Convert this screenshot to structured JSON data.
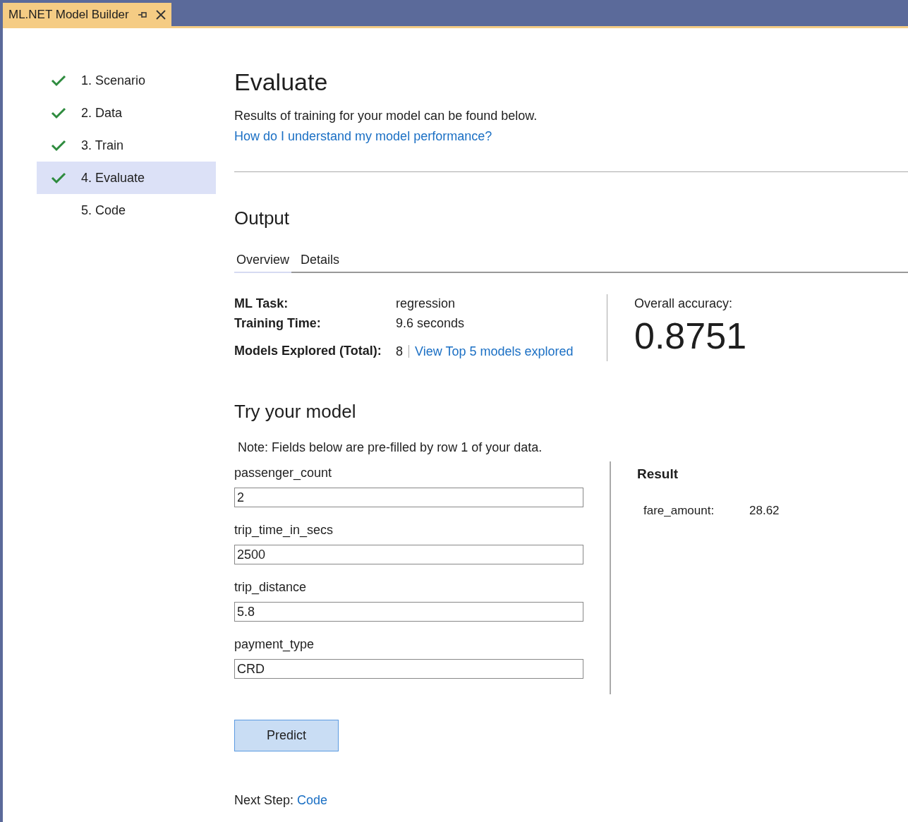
{
  "window": {
    "tab_title": "ML.NET Model Builder"
  },
  "steps": [
    {
      "label": "1. Scenario",
      "completed": true,
      "selected": false
    },
    {
      "label": "2. Data",
      "completed": true,
      "selected": false
    },
    {
      "label": "3. Train",
      "completed": true,
      "selected": false
    },
    {
      "label": "4. Evaluate",
      "completed": true,
      "selected": true
    },
    {
      "label": "5. Code",
      "completed": false,
      "selected": false
    }
  ],
  "page": {
    "title": "Evaluate",
    "intro": "Results of training for your model can be found below.",
    "help_link": "How do I understand my model performance?"
  },
  "output": {
    "heading": "Output",
    "tabs": [
      {
        "label": "Overview",
        "selected": true
      },
      {
        "label": "Details",
        "selected": false
      }
    ],
    "ml_task_label": "ML Task:",
    "ml_task": "regression",
    "training_time_label": "Training Time:",
    "training_time": "9.6 seconds",
    "models_label": "Models Explored (Total):",
    "models_count": "8",
    "models_link": "View Top 5 models explored",
    "accuracy_label": "Overall accuracy:",
    "accuracy": "0.8751"
  },
  "try": {
    "heading": "Try your model",
    "note": "Note: Fields below are pre-filled by row 1 of your data.",
    "fields": [
      {
        "label": "passenger_count",
        "value": "2"
      },
      {
        "label": "trip_time_in_secs",
        "value": "2500"
      },
      {
        "label": "trip_distance",
        "value": "5.8"
      },
      {
        "label": "payment_type",
        "value": "CRD"
      }
    ],
    "result_heading": "Result",
    "result_label": "fare_amount:",
    "result_value": "28.62",
    "predict_button": "Predict"
  },
  "next_step": {
    "label": "Next Step:",
    "link": "Code"
  }
}
